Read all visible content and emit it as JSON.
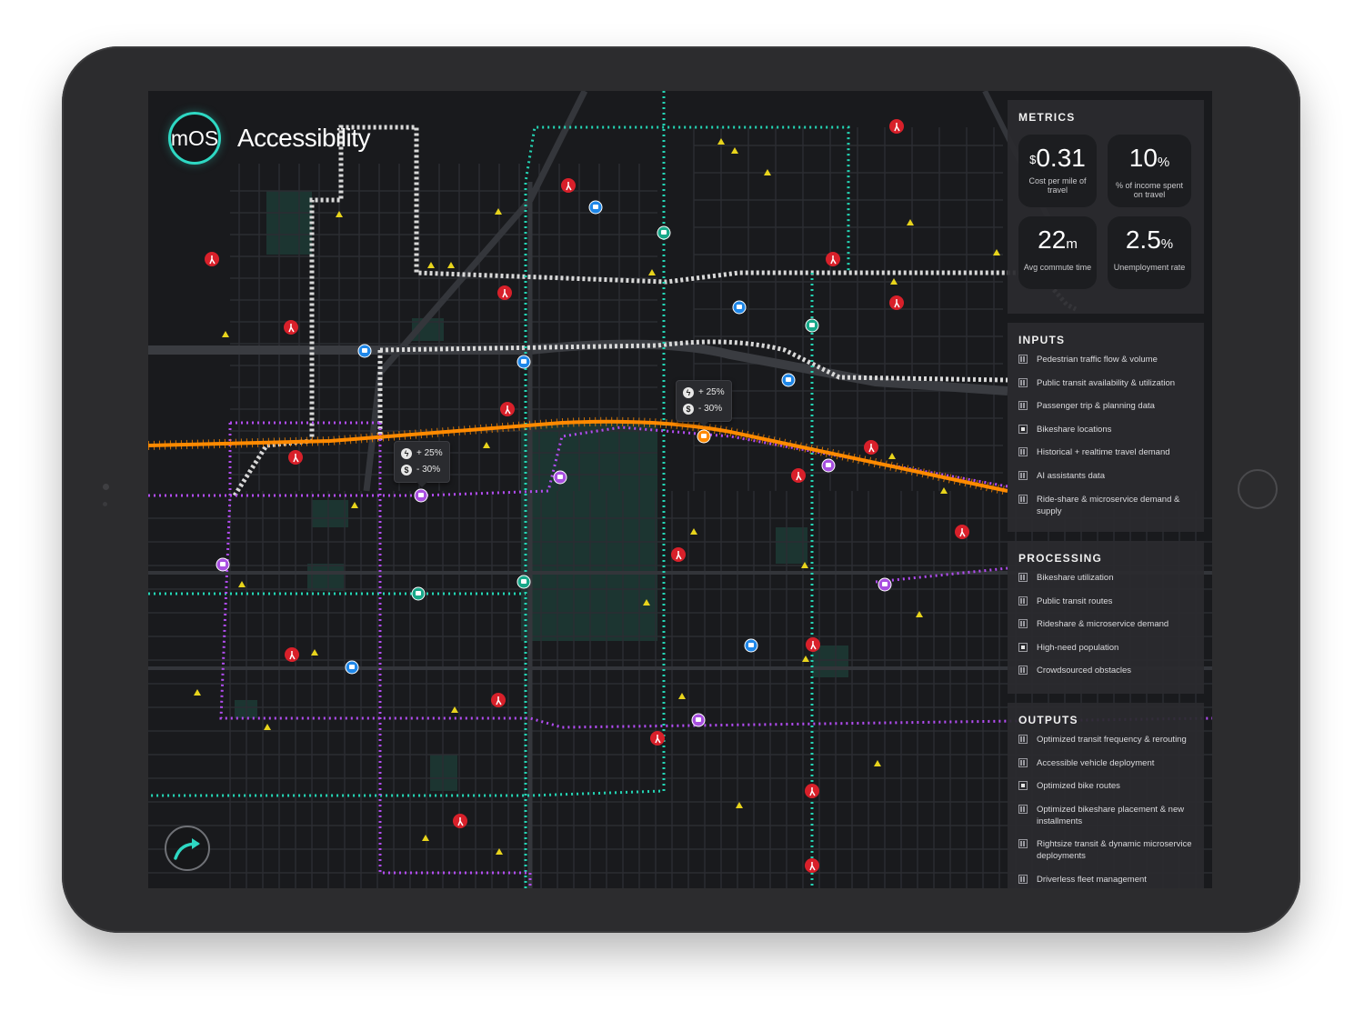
{
  "app": {
    "logo_text": "mOS",
    "title": "Accessibility"
  },
  "metrics": {
    "heading": "METRICS",
    "items": [
      {
        "prefix": "$",
        "value": "0.31",
        "suffix": "",
        "label": "Cost per mile of travel"
      },
      {
        "prefix": "",
        "value": "10",
        "suffix": "%",
        "label": "% of income spent on travel"
      },
      {
        "prefix": "",
        "value": "22",
        "suffix": "m",
        "label": "Avg commute time"
      },
      {
        "prefix": "",
        "value": "2.5",
        "suffix": "%",
        "label": "Unemployment rate"
      }
    ]
  },
  "inputs": {
    "heading": "INPUTS",
    "items": [
      {
        "label": "Pedestrian traffic flow & volume",
        "state": "partial"
      },
      {
        "label": "Public transit availability & utilization",
        "state": "partial"
      },
      {
        "label": "Passenger trip & planning data",
        "state": "partial"
      },
      {
        "label": "Bikeshare locations",
        "state": "checked"
      },
      {
        "label": "Historical + realtime travel demand",
        "state": "partial"
      },
      {
        "label": "AI assistants data",
        "state": "partial"
      },
      {
        "label": "Ride-share & microservice demand & supply",
        "state": "partial"
      }
    ]
  },
  "processing": {
    "heading": "PROCESSING",
    "items": [
      {
        "label": "Bikeshare utilization",
        "state": "partial"
      },
      {
        "label": "Public transit routes",
        "state": "partial"
      },
      {
        "label": "Rideshare & microservice demand",
        "state": "partial"
      },
      {
        "label": "High-need population",
        "state": "checked"
      },
      {
        "label": "Crowdsourced obstacles",
        "state": "partial"
      }
    ]
  },
  "outputs": {
    "heading": "OUTPUTS",
    "items": [
      {
        "label": "Optimized transit frequency & rerouting",
        "state": "partial"
      },
      {
        "label": "Accessible vehicle deployment",
        "state": "partial"
      },
      {
        "label": "Optimized bike routes",
        "state": "checked"
      },
      {
        "label": "Optimized bikeshare placement & new installments",
        "state": "partial"
      },
      {
        "label": "Rightsize transit & dynamic microservice deployments",
        "state": "partial"
      },
      {
        "label": "Driverless fleet management",
        "state": "partial"
      }
    ]
  },
  "tooltips": [
    {
      "line1": "+ 25%",
      "line2": "- 30%",
      "icon1": "bolt-icon",
      "icon2": "dollar-icon"
    },
    {
      "line1": "+ 25%",
      "line2": "- 30%",
      "icon1": "bolt-icon",
      "icon2": "dollar-icon"
    }
  ],
  "colors": {
    "accent_teal": "#2ed8c3",
    "route_orange": "#ff8a00",
    "route_purple": "#b14cf0",
    "route_teal": "#24d4b4",
    "pedestrian_red": "#d8202a",
    "bus_blue": "#1f87e8",
    "bus_purple": "#a84fe0",
    "bus_green": "#17a889",
    "hazard_yellow": "#e8d41c"
  }
}
